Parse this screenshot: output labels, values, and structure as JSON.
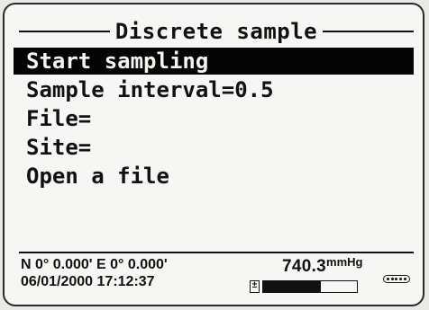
{
  "screen": {
    "title": "Discrete sample",
    "menu": [
      {
        "label": "Start sampling",
        "selected": true
      },
      {
        "label": "Sample interval=0.5",
        "selected": false
      },
      {
        "label": "File=",
        "selected": false
      },
      {
        "label": "Site=",
        "selected": false
      },
      {
        "label": "Open a file",
        "selected": false
      }
    ]
  },
  "status": {
    "gps": "N 0° 0.000' E  0° 0.000'",
    "datetime": "06/01/2000 17:12:37",
    "pressure_value": "740.3",
    "pressure_unit": "mmHg",
    "battery_level_percent": 62,
    "battery_icon": "battery-icon",
    "battery_glyph": "±",
    "link_icon": "connection-status-icon"
  }
}
